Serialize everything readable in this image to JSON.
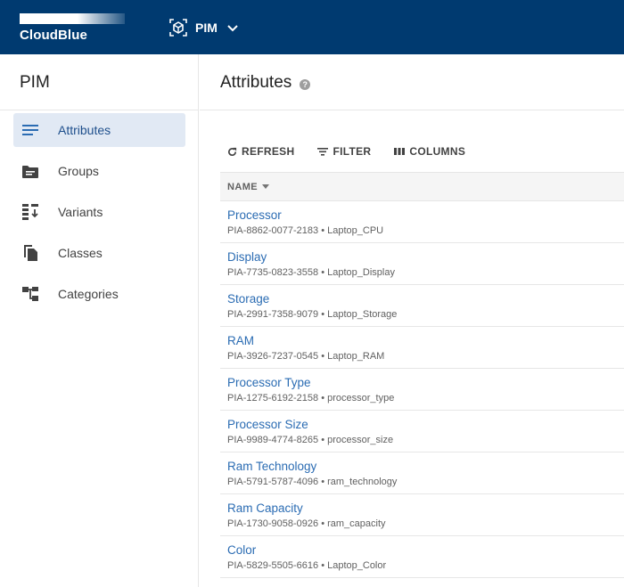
{
  "topbar": {
    "logo_text": "CloudBlue",
    "app_name": "PIM"
  },
  "sidebar": {
    "title": "PIM",
    "items": [
      {
        "label": "Attributes",
        "icon": "list-icon",
        "active": true
      },
      {
        "label": "Groups",
        "icon": "folder-icon",
        "active": false
      },
      {
        "label": "Variants",
        "icon": "variants-icon",
        "active": false
      },
      {
        "label": "Classes",
        "icon": "copy-icon",
        "active": false
      },
      {
        "label": "Categories",
        "icon": "tree-icon",
        "active": false
      }
    ]
  },
  "main": {
    "title": "Attributes",
    "help_glyph": "?",
    "toolbar": {
      "refresh": "REFRESH",
      "filter": "FILTER",
      "columns": "COLUMNS"
    },
    "table": {
      "header_name": "NAME",
      "rows": [
        {
          "name": "Processor",
          "id": "PIA-8862-0077-2183",
          "key": "Laptop_CPU"
        },
        {
          "name": "Display",
          "id": "PIA-7735-0823-3558",
          "key": "Laptop_Display"
        },
        {
          "name": "Storage",
          "id": "PIA-2991-7358-9079",
          "key": "Laptop_Storage"
        },
        {
          "name": "RAM",
          "id": "PIA-3926-7237-0545",
          "key": "Laptop_RAM"
        },
        {
          "name": "Processor Type",
          "id": "PIA-1275-6192-2158",
          "key": "processor_type"
        },
        {
          "name": "Processor Size",
          "id": "PIA-9989-4774-8265",
          "key": "processor_size"
        },
        {
          "name": "Ram Technology",
          "id": "PIA-5791-5787-4096",
          "key": "ram_technology"
        },
        {
          "name": "Ram Capacity",
          "id": "PIA-1730-9058-0926",
          "key": "ram_capacity"
        },
        {
          "name": "Color",
          "id": "PIA-5829-5505-6616",
          "key": "Laptop_Color"
        }
      ]
    }
  },
  "colors": {
    "topbar": "#003a70",
    "link": "#2b6cb3",
    "active_bg": "#e1e9f4"
  }
}
